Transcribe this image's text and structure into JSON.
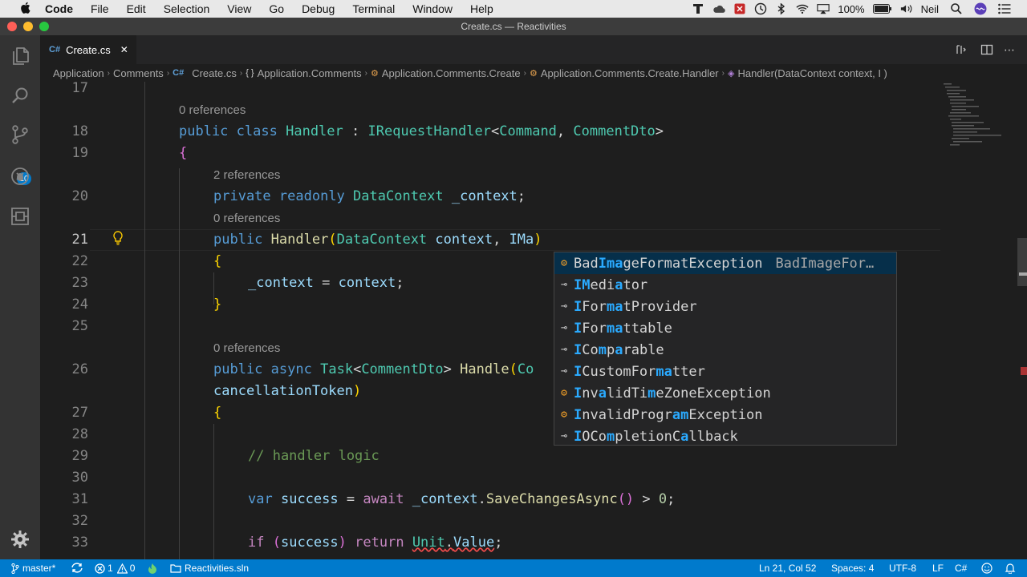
{
  "menubar": {
    "app": "Code",
    "items": [
      "File",
      "Edit",
      "Selection",
      "View",
      "Go",
      "Debug",
      "Terminal",
      "Window",
      "Help"
    ],
    "battery": "100%",
    "user": "Neil"
  },
  "window": {
    "title": "Create.cs — Reactivities"
  },
  "tab": {
    "icon": "C#",
    "label": "Create.cs"
  },
  "breadcrumb": [
    "Application",
    "Comments",
    "Create.cs",
    "Application.Comments",
    "Application.Comments.Create",
    "Application.Comments.Create.Handler",
    "Handler(DataContext context, I )"
  ],
  "breadcrumb_icons": {
    "file": "C#",
    "namespace": "{ }"
  },
  "activity": {
    "scm_badge": "10"
  },
  "lenses": {
    "l18": "0 references",
    "l20": "2 references",
    "l21": "0 references",
    "l26": "0 references"
  },
  "lines": {
    "n17": "17",
    "n18": "18",
    "n19": "19",
    "n20": "20",
    "n21": "21",
    "n22": "22",
    "n23": "23",
    "n24": "24",
    "n25": "25",
    "n26": "26",
    "n27": "27",
    "n28": "28",
    "n29": "29",
    "n30": "30",
    "n31": "31",
    "n32": "32",
    "n33": "33"
  },
  "code": {
    "public": "public",
    "class": "class",
    "private": "private",
    "readonly": "readonly",
    "async": "async",
    "var": "var",
    "await": "await",
    "if": "if",
    "return": "return",
    "Handler": "Handler",
    "IRequestHandler": "IRequestHandler",
    "Command": "Command",
    "CommentDto": "CommentDto",
    "DataContext": "DataContext",
    "_context": "_context",
    "context": "context",
    "IMa": "IMa",
    "Task": "Task",
    "Handle": "Handle",
    "Co": "Co",
    "cancellationToken": "cancellationToken",
    "comment": "// handler logic",
    "success": "success",
    "SaveChangesAsync": "SaveChangesAsync",
    "zero": "0",
    "Unit": "Unit",
    "Value": "Value"
  },
  "suggest": {
    "items": [
      {
        "kind": "class",
        "parts": [
          "Bad",
          "Ima",
          "geFormatException"
        ],
        "detail": "BadImageFor…"
      },
      {
        "kind": "interface",
        "parts": [
          "",
          "IM",
          "edi",
          "a",
          "tor"
        ]
      },
      {
        "kind": "interface",
        "parts": [
          "",
          "I",
          "For",
          "ma",
          "tProvider"
        ]
      },
      {
        "kind": "interface",
        "parts": [
          "",
          "I",
          "For",
          "ma",
          "ttable"
        ]
      },
      {
        "kind": "interface",
        "parts": [
          "",
          "I",
          "Co",
          "m",
          "p",
          "a",
          "rable"
        ]
      },
      {
        "kind": "interface",
        "parts": [
          "",
          "I",
          "CustomFor",
          "ma",
          "tter"
        ]
      },
      {
        "kind": "class",
        "parts": [
          "",
          "I",
          "nv",
          "a",
          "lidTi",
          "m",
          "eZoneException"
        ]
      },
      {
        "kind": "class",
        "parts": [
          "",
          "I",
          "nvalidProgr",
          "am",
          "Exception"
        ]
      },
      {
        "kind": "interface",
        "parts": [
          "",
          "I",
          "OCo",
          "m",
          "pletionC",
          "a",
          "llback"
        ]
      }
    ]
  },
  "status": {
    "branch": "master*",
    "errors": "1",
    "warnings": "0",
    "solution": "Reactivities.sln",
    "position": "Ln 21, Col 52",
    "spaces": "Spaces: 4",
    "encoding": "UTF-8",
    "eol": "LF",
    "language": "C#"
  },
  "colors": {
    "accent": "#007acc",
    "editor_bg": "#1e1e1e",
    "suggest_highlight": "#2aaaff"
  }
}
